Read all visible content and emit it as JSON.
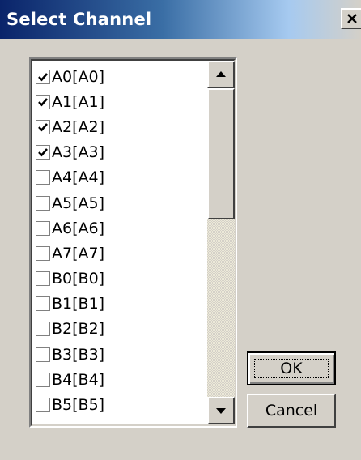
{
  "window": {
    "title": "Select Channel",
    "close_label": "Close"
  },
  "channels": [
    {
      "label": "A0[A0]",
      "checked": true
    },
    {
      "label": "A1[A1]",
      "checked": true
    },
    {
      "label": "A2[A2]",
      "checked": true
    },
    {
      "label": "A3[A3]",
      "checked": true
    },
    {
      "label": "A4[A4]",
      "checked": false
    },
    {
      "label": "A5[A5]",
      "checked": false
    },
    {
      "label": "A6[A6]",
      "checked": false
    },
    {
      "label": "A7[A7]",
      "checked": false
    },
    {
      "label": "B0[B0]",
      "checked": false
    },
    {
      "label": "B1[B1]",
      "checked": false
    },
    {
      "label": "B2[B2]",
      "checked": false
    },
    {
      "label": "B3[B3]",
      "checked": false
    },
    {
      "label": "B4[B4]",
      "checked": false
    },
    {
      "label": "B5[B5]",
      "checked": false
    }
  ],
  "buttons": {
    "ok_label": "OK",
    "cancel_label": "Cancel"
  },
  "icons": {
    "close": "close-icon",
    "scroll_up": "scroll-up-arrow-icon",
    "scroll_down": "scroll-down-arrow-icon",
    "checkmark": "checkmark-icon"
  },
  "colors": {
    "title_gradient_start": "#0a246a",
    "title_gradient_end": "#d4d0c8",
    "dialog_face": "#d4d0c8"
  }
}
